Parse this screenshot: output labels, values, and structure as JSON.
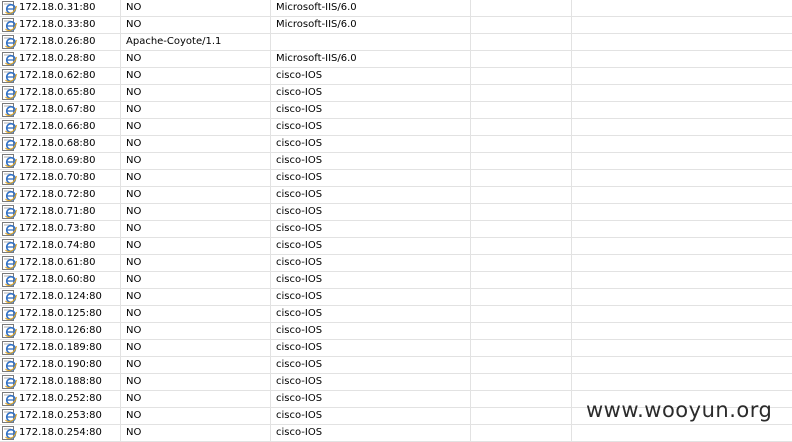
{
  "rows": [
    {
      "host": "172.18.0.31:80",
      "col2": "NO",
      "col3": "Microsoft-IIS/6.0"
    },
    {
      "host": "172.18.0.33:80",
      "col2": "NO",
      "col3": "Microsoft-IIS/6.0"
    },
    {
      "host": "172.18.0.26:80",
      "col2": "Apache-Coyote/1.1",
      "col3": ""
    },
    {
      "host": "172.18.0.28:80",
      "col2": "NO",
      "col3": "Microsoft-IIS/6.0"
    },
    {
      "host": "172.18.0.62:80",
      "col2": "NO",
      "col3": "cisco-IOS"
    },
    {
      "host": "172.18.0.65:80",
      "col2": "NO",
      "col3": "cisco-IOS"
    },
    {
      "host": "172.18.0.67:80",
      "col2": "NO",
      "col3": "cisco-IOS"
    },
    {
      "host": "172.18.0.66:80",
      "col2": "NO",
      "col3": "cisco-IOS"
    },
    {
      "host": "172.18.0.68:80",
      "col2": "NO",
      "col3": "cisco-IOS"
    },
    {
      "host": "172.18.0.69:80",
      "col2": "NO",
      "col3": "cisco-IOS"
    },
    {
      "host": "172.18.0.70:80",
      "col2": "NO",
      "col3": "cisco-IOS"
    },
    {
      "host": "172.18.0.72:80",
      "col2": "NO",
      "col3": "cisco-IOS"
    },
    {
      "host": "172.18.0.71:80",
      "col2": "NO",
      "col3": "cisco-IOS"
    },
    {
      "host": "172.18.0.73:80",
      "col2": "NO",
      "col3": "cisco-IOS"
    },
    {
      "host": "172.18.0.74:80",
      "col2": "NO",
      "col3": "cisco-IOS"
    },
    {
      "host": "172.18.0.61:80",
      "col2": "NO",
      "col3": "cisco-IOS"
    },
    {
      "host": "172.18.0.60:80",
      "col2": "NO",
      "col3": "cisco-IOS"
    },
    {
      "host": "172.18.0.124:80",
      "col2": "NO",
      "col3": "cisco-IOS"
    },
    {
      "host": "172.18.0.125:80",
      "col2": "NO",
      "col3": "cisco-IOS"
    },
    {
      "host": "172.18.0.126:80",
      "col2": "NO",
      "col3": "cisco-IOS"
    },
    {
      "host": "172.18.0.189:80",
      "col2": "NO",
      "col3": "cisco-IOS"
    },
    {
      "host": "172.18.0.190:80",
      "col2": "NO",
      "col3": "cisco-IOS"
    },
    {
      "host": "172.18.0.188:80",
      "col2": "NO",
      "col3": "cisco-IOS"
    },
    {
      "host": "172.18.0.252:80",
      "col2": "NO",
      "col3": "cisco-IOS"
    },
    {
      "host": "172.18.0.253:80",
      "col2": "NO",
      "col3": "cisco-IOS"
    },
    {
      "host": "172.18.0.254:80",
      "col2": "NO",
      "col3": "cisco-IOS"
    }
  ],
  "row_icon": "ie-globe-icon",
  "watermark": "www.wooyun.org",
  "colors": {
    "gridline": "#e2e2e2",
    "icon_blue": "#2f6fc4",
    "icon_frame": "#7a7a7a"
  }
}
